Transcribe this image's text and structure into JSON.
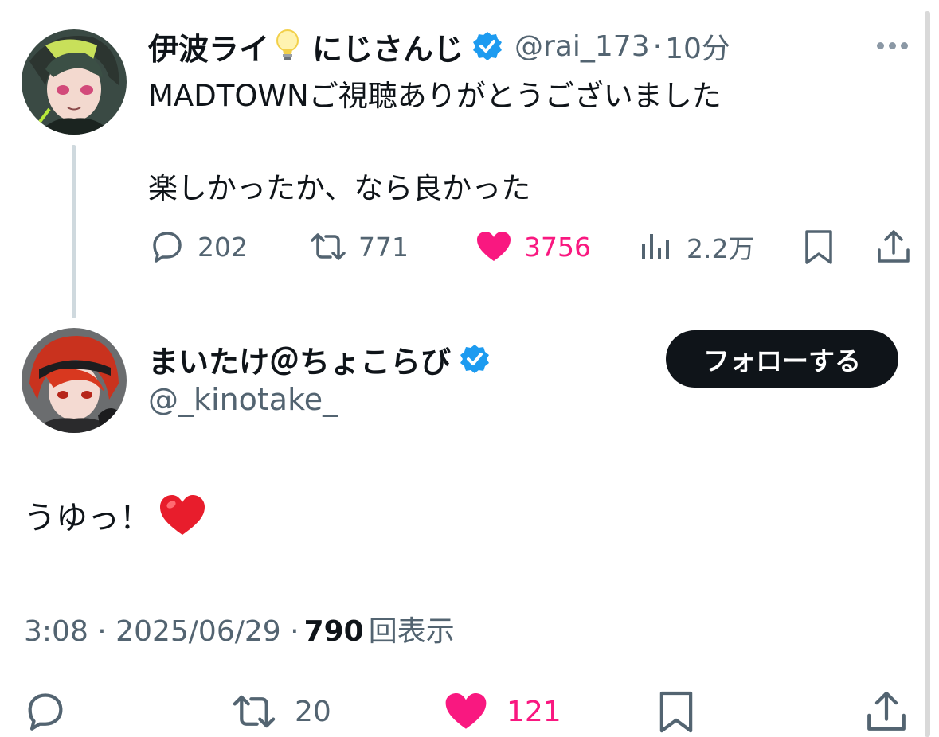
{
  "tweet": {
    "author_name": "伊波ライ",
    "author_suffix": "にじさんじ",
    "handle": "@rai_173",
    "separator": "·",
    "time": "10分",
    "text": "MADTOWNご視聴ありがとうございました\n\n楽しかったか、なら良かった",
    "replies": "202",
    "retweets": "771",
    "likes": "3756",
    "views": "2.2万"
  },
  "reply": {
    "author_name": "まいたけ＠ちょこらび",
    "handle": "@_kinotake_",
    "follow_label": "フォローする",
    "text": "うゆっ！",
    "timestamp": "3:08 · 2025/06/29 ·",
    "view_count": "790",
    "view_label": "回表示",
    "retweets": "20",
    "likes": "121"
  },
  "colors": {
    "accent_pink": "#f91880",
    "verified_blue": "#1d9bf0",
    "text_secondary": "#536471",
    "follow_bg": "#0f1419"
  },
  "icons": [
    "reply-icon",
    "retweet-icon",
    "like-icon",
    "views-icon",
    "bookmark-icon",
    "share-icon",
    "verified-icon",
    "more-icon",
    "lightbulb-icon",
    "red-heart-icon"
  ]
}
